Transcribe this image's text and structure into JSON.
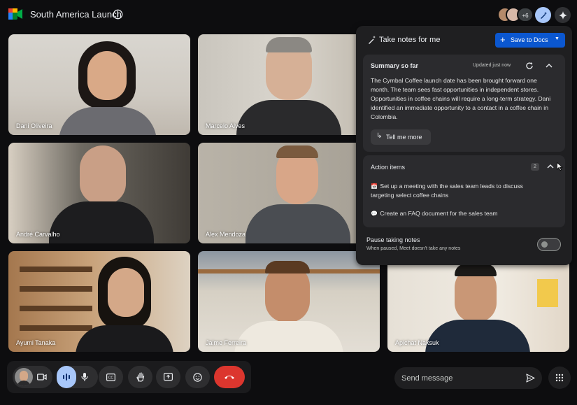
{
  "meeting": {
    "title": "South America Launch"
  },
  "participants_more": "+6",
  "tiles": [
    {
      "name": "Dani Oliveira"
    },
    {
      "name": "Marcelo Alves"
    },
    {
      "name": "André Carvalho"
    },
    {
      "name": "Alex Mendoza"
    },
    {
      "name": "Ayumi Tanaka"
    },
    {
      "name": "Jaime Ferreira"
    },
    {
      "name": "Apichat Naksuk"
    }
  ],
  "notes_panel": {
    "title": "Take notes for me",
    "save_label": "Save to Docs",
    "summary": {
      "title": "Summary so far",
      "updated": "Updated just now",
      "text": "The Cymbal Coffee launch date has been brought forward one month. The team sees fast opportunities in independent stores. Opportunities in coffee chains will require a long-term strategy. Dani identified an immediate opportunity to a contact in a coffee chain in Colombia.",
      "tell_more_label": "Tell me more"
    },
    "action_items": {
      "title": "Action items",
      "count": "2",
      "items": [
        {
          "icon": "calendar-icon",
          "text": "Set up a meeting with the sales team leads to discuss targeting select coffee chains"
        },
        {
          "icon": "chat-icon",
          "text": "Create an FAQ document for the sales team"
        }
      ]
    },
    "pause": {
      "title": "Pause taking notes",
      "subtitle": "When paused, Meet doesn't take any notes",
      "enabled": false
    }
  },
  "message": {
    "placeholder": "Send message"
  },
  "colors": {
    "accent_blue": "#a8c7fa",
    "save_button": "#0b57d0",
    "hangup_red": "#dc362e",
    "panel_bg": "#1f1f21"
  }
}
